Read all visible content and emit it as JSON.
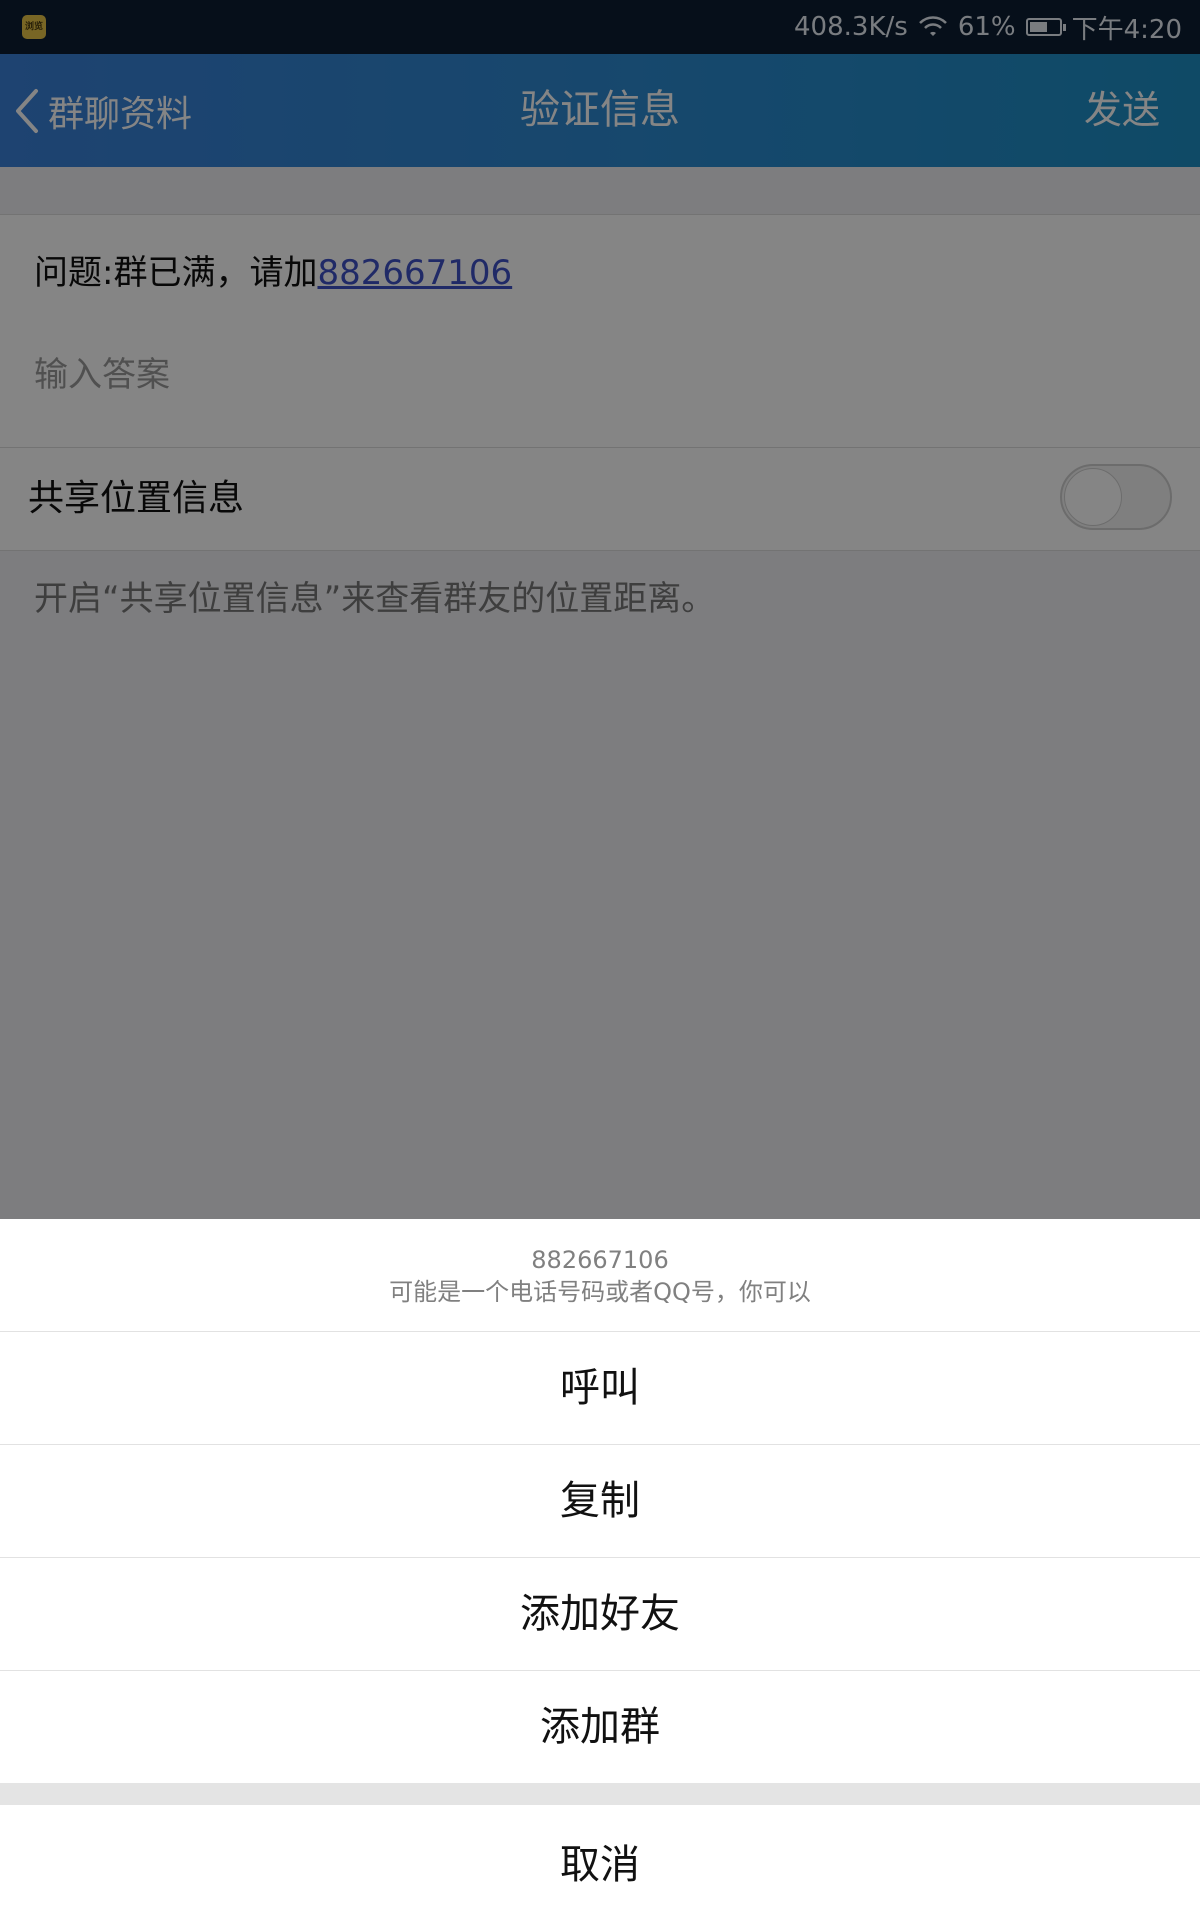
{
  "status_bar": {
    "app_icon_label": "浏览",
    "net_speed": "408.3K/s",
    "battery": "61%",
    "battery_level": 0.61,
    "time": "下午4:20"
  },
  "nav": {
    "back_label": "群聊资料",
    "title": "验证信息",
    "send_label": "发送"
  },
  "form": {
    "question_prefix": "问题:群已满，请加",
    "question_link": "882667106",
    "answer_placeholder": "输入答案",
    "share_label": "共享位置信息",
    "share_enabled": false,
    "share_hint": "开启“共享位置信息”来查看群友的位置距离。"
  },
  "sheet": {
    "number": "882667106",
    "description": "可能是一个电话号码或者QQ号，你可以",
    "items": [
      "呼叫",
      "复制",
      "添加好友",
      "添加群"
    ],
    "cancel": "取消"
  },
  "colors": {
    "nav_start": "#3a80d8",
    "nav_end": "#1d8fc4",
    "link": "#3f51c6"
  }
}
